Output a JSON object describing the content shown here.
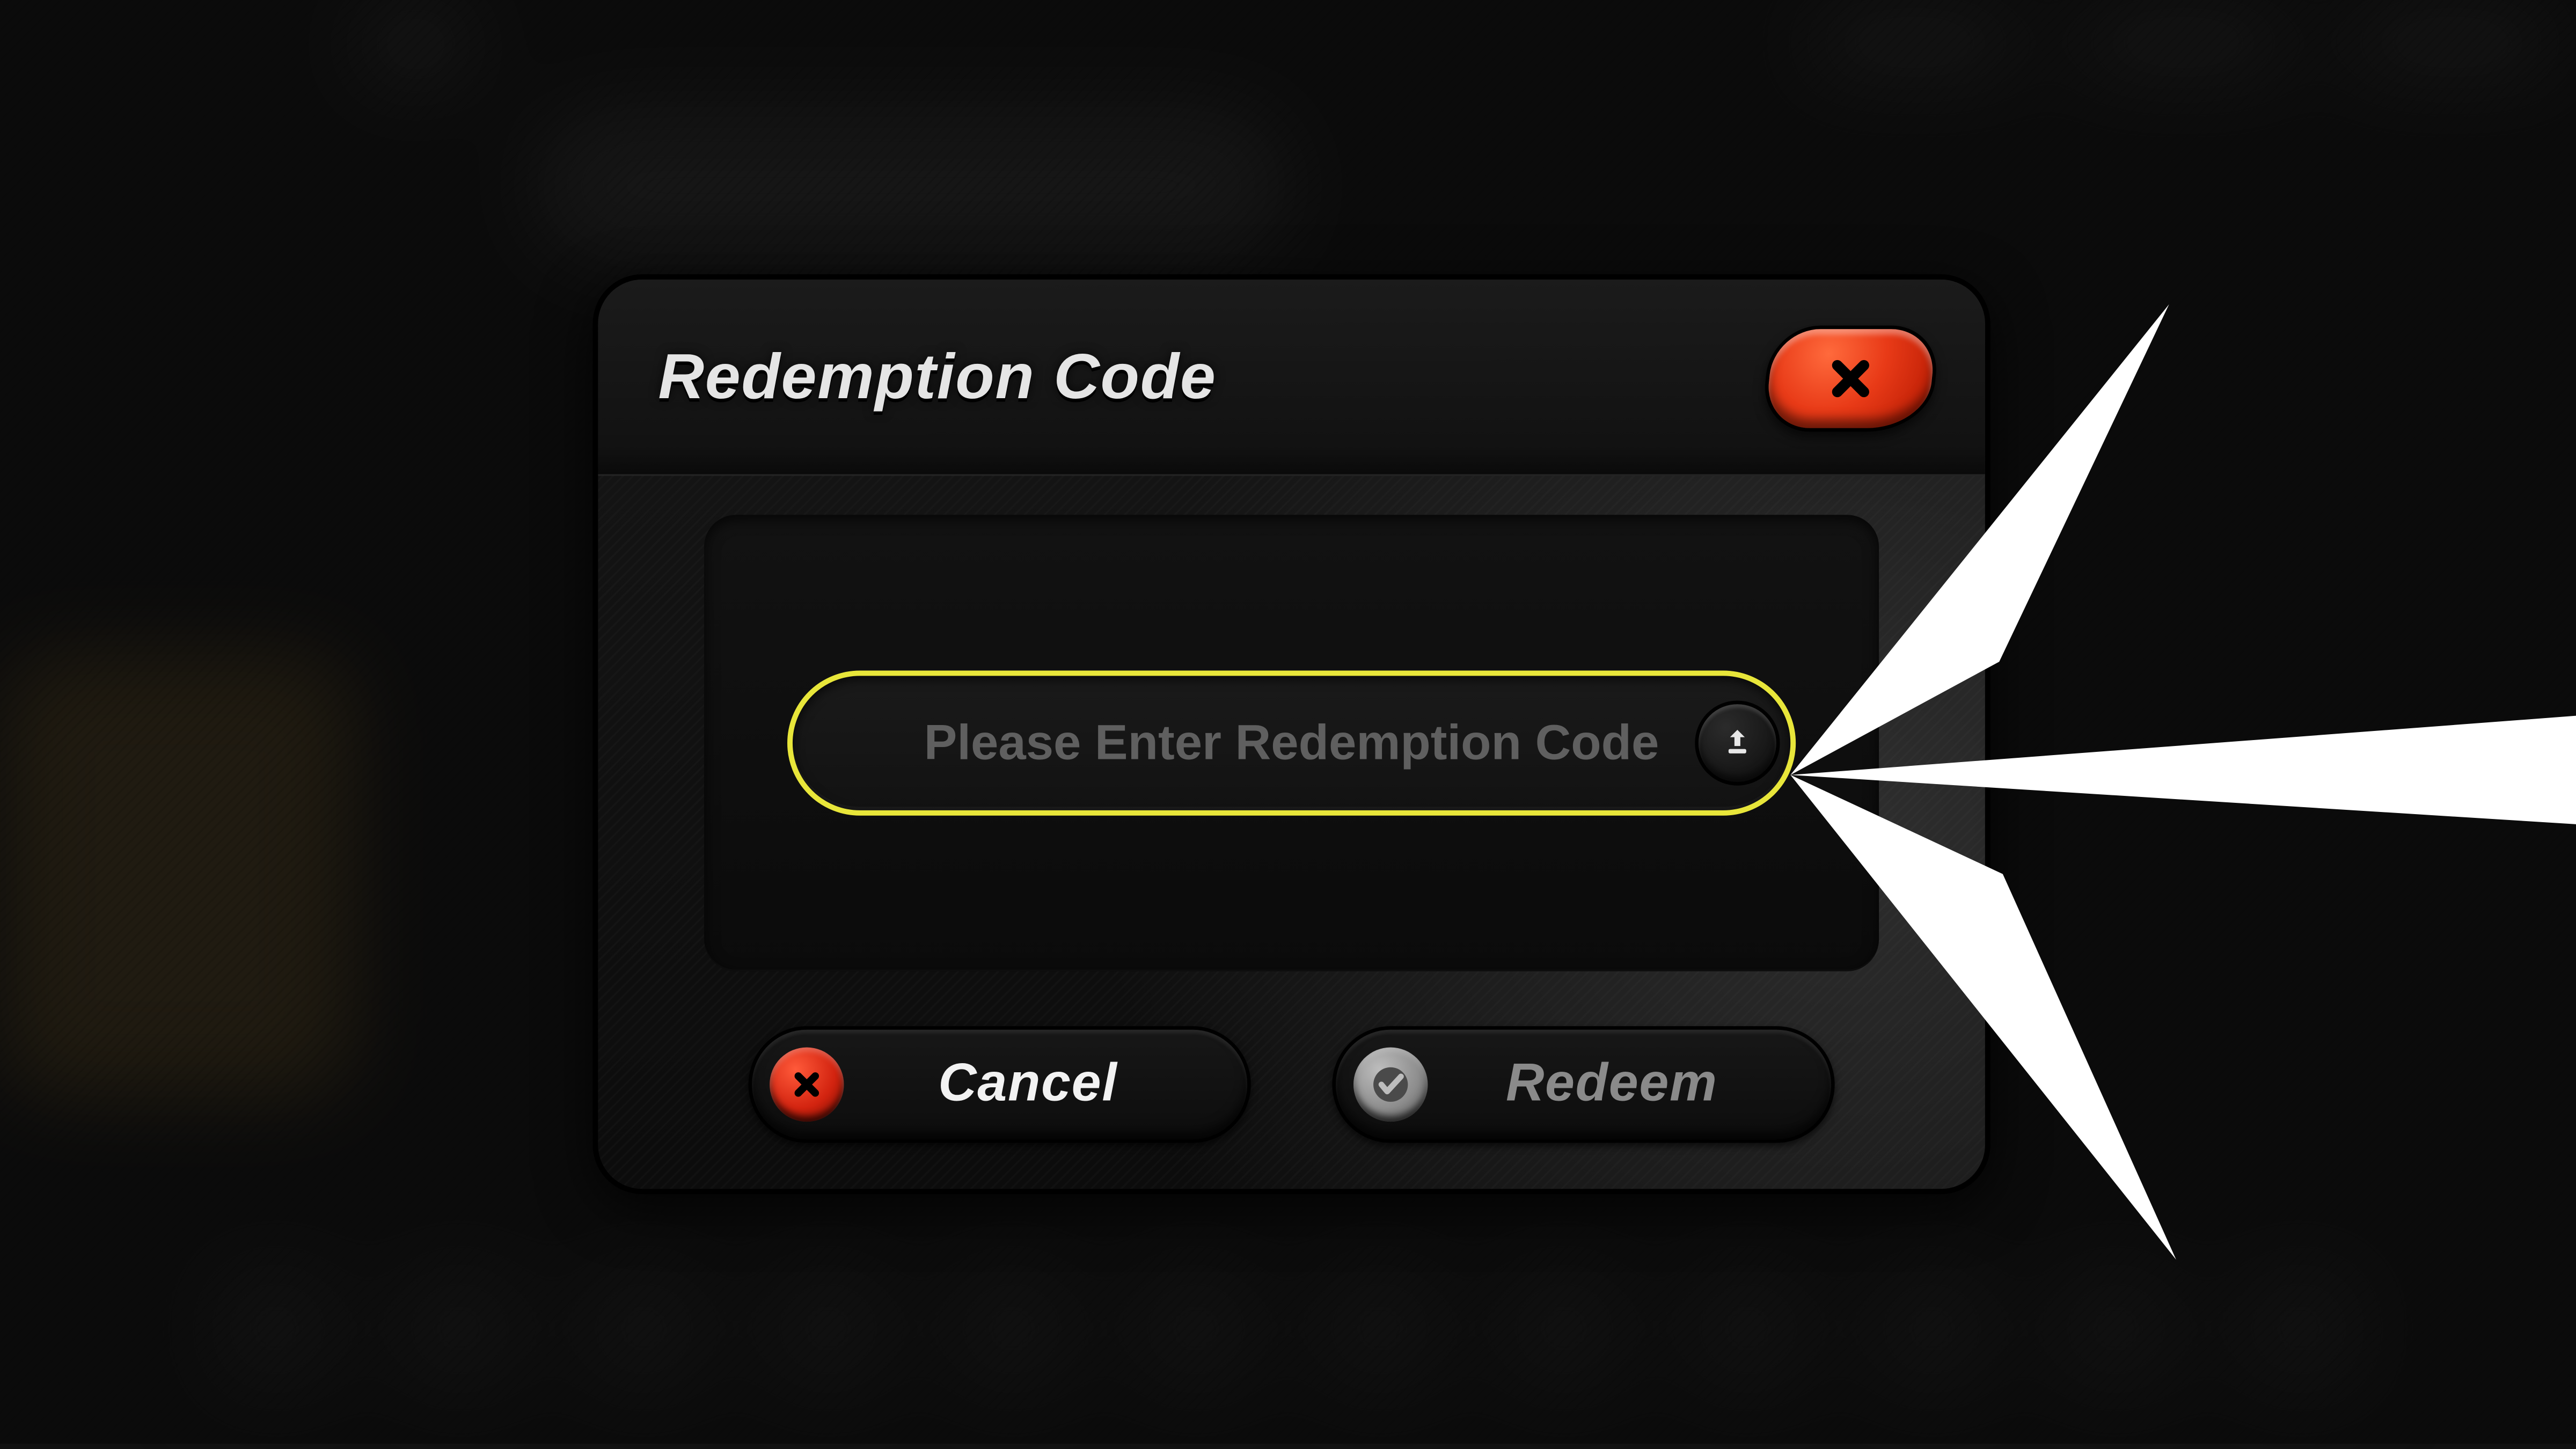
{
  "modal": {
    "title": "Redemption Code",
    "input": {
      "value": "",
      "placeholder": "Please Enter Redemption Code"
    },
    "close_label": "Close",
    "paste_label": "Paste from clipboard",
    "actions": {
      "cancel_label": "Cancel",
      "redeem_label": "Redeem"
    }
  },
  "colors": {
    "accent_yellow": "#e8e63a",
    "button_red": "#e23a1f"
  },
  "overlay": {
    "pointer_arrow": "white-pointer-arrow"
  }
}
